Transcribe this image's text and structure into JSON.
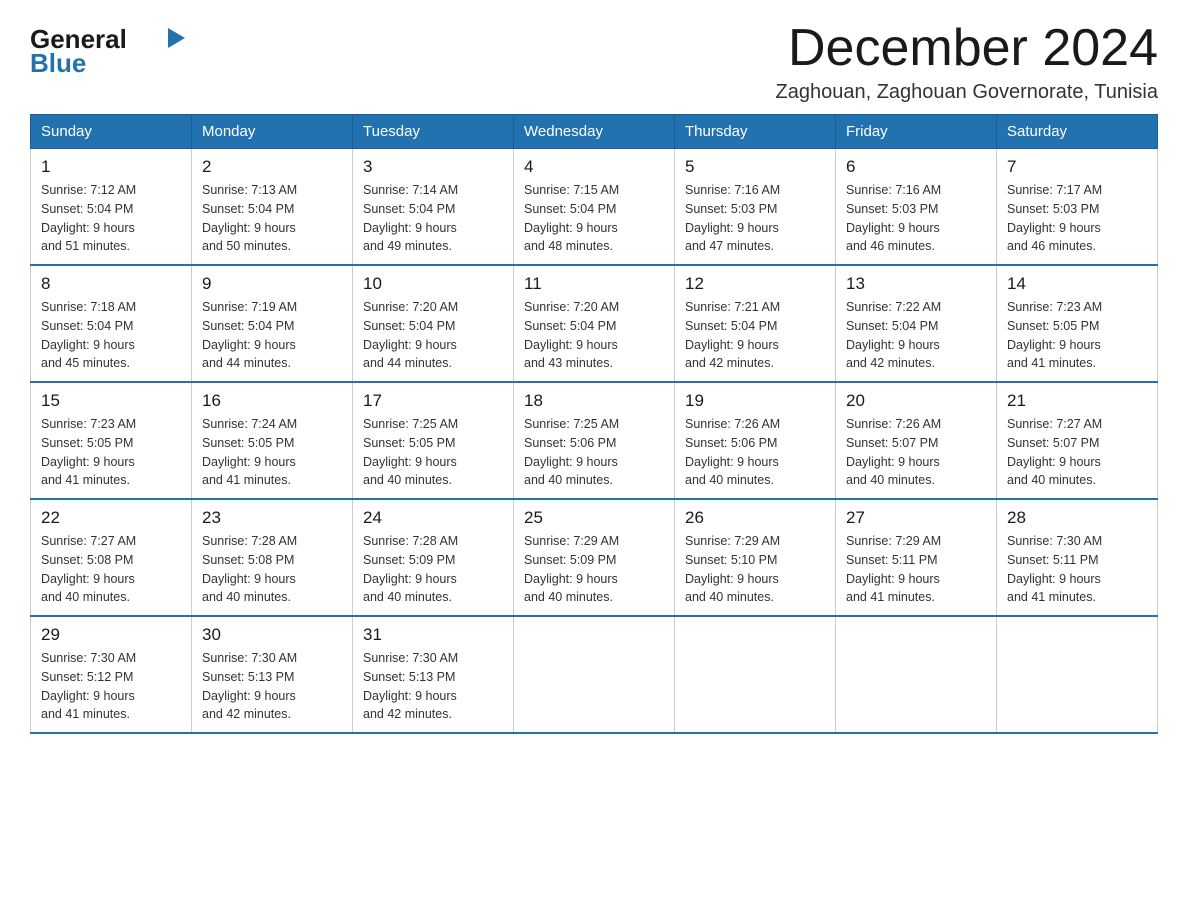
{
  "header": {
    "logo_text_general": "General",
    "logo_text_blue": "Blue",
    "month_title": "December 2024",
    "location": "Zaghouan, Zaghouan Governorate, Tunisia"
  },
  "weekdays": [
    "Sunday",
    "Monday",
    "Tuesday",
    "Wednesday",
    "Thursday",
    "Friday",
    "Saturday"
  ],
  "weeks": [
    [
      {
        "day": "1",
        "sunrise": "7:12 AM",
        "sunset": "5:04 PM",
        "daylight": "9 hours and 51 minutes."
      },
      {
        "day": "2",
        "sunrise": "7:13 AM",
        "sunset": "5:04 PM",
        "daylight": "9 hours and 50 minutes."
      },
      {
        "day": "3",
        "sunrise": "7:14 AM",
        "sunset": "5:04 PM",
        "daylight": "9 hours and 49 minutes."
      },
      {
        "day": "4",
        "sunrise": "7:15 AM",
        "sunset": "5:04 PM",
        "daylight": "9 hours and 48 minutes."
      },
      {
        "day": "5",
        "sunrise": "7:16 AM",
        "sunset": "5:03 PM",
        "daylight": "9 hours and 47 minutes."
      },
      {
        "day": "6",
        "sunrise": "7:16 AM",
        "sunset": "5:03 PM",
        "daylight": "9 hours and 46 minutes."
      },
      {
        "day": "7",
        "sunrise": "7:17 AM",
        "sunset": "5:03 PM",
        "daylight": "9 hours and 46 minutes."
      }
    ],
    [
      {
        "day": "8",
        "sunrise": "7:18 AM",
        "sunset": "5:04 PM",
        "daylight": "9 hours and 45 minutes."
      },
      {
        "day": "9",
        "sunrise": "7:19 AM",
        "sunset": "5:04 PM",
        "daylight": "9 hours and 44 minutes."
      },
      {
        "day": "10",
        "sunrise": "7:20 AM",
        "sunset": "5:04 PM",
        "daylight": "9 hours and 44 minutes."
      },
      {
        "day": "11",
        "sunrise": "7:20 AM",
        "sunset": "5:04 PM",
        "daylight": "9 hours and 43 minutes."
      },
      {
        "day": "12",
        "sunrise": "7:21 AM",
        "sunset": "5:04 PM",
        "daylight": "9 hours and 42 minutes."
      },
      {
        "day": "13",
        "sunrise": "7:22 AM",
        "sunset": "5:04 PM",
        "daylight": "9 hours and 42 minutes."
      },
      {
        "day": "14",
        "sunrise": "7:23 AM",
        "sunset": "5:05 PM",
        "daylight": "9 hours and 41 minutes."
      }
    ],
    [
      {
        "day": "15",
        "sunrise": "7:23 AM",
        "sunset": "5:05 PM",
        "daylight": "9 hours and 41 minutes."
      },
      {
        "day": "16",
        "sunrise": "7:24 AM",
        "sunset": "5:05 PM",
        "daylight": "9 hours and 41 minutes."
      },
      {
        "day": "17",
        "sunrise": "7:25 AM",
        "sunset": "5:05 PM",
        "daylight": "9 hours and 40 minutes."
      },
      {
        "day": "18",
        "sunrise": "7:25 AM",
        "sunset": "5:06 PM",
        "daylight": "9 hours and 40 minutes."
      },
      {
        "day": "19",
        "sunrise": "7:26 AM",
        "sunset": "5:06 PM",
        "daylight": "9 hours and 40 minutes."
      },
      {
        "day": "20",
        "sunrise": "7:26 AM",
        "sunset": "5:07 PM",
        "daylight": "9 hours and 40 minutes."
      },
      {
        "day": "21",
        "sunrise": "7:27 AM",
        "sunset": "5:07 PM",
        "daylight": "9 hours and 40 minutes."
      }
    ],
    [
      {
        "day": "22",
        "sunrise": "7:27 AM",
        "sunset": "5:08 PM",
        "daylight": "9 hours and 40 minutes."
      },
      {
        "day": "23",
        "sunrise": "7:28 AM",
        "sunset": "5:08 PM",
        "daylight": "9 hours and 40 minutes."
      },
      {
        "day": "24",
        "sunrise": "7:28 AM",
        "sunset": "5:09 PM",
        "daylight": "9 hours and 40 minutes."
      },
      {
        "day": "25",
        "sunrise": "7:29 AM",
        "sunset": "5:09 PM",
        "daylight": "9 hours and 40 minutes."
      },
      {
        "day": "26",
        "sunrise": "7:29 AM",
        "sunset": "5:10 PM",
        "daylight": "9 hours and 40 minutes."
      },
      {
        "day": "27",
        "sunrise": "7:29 AM",
        "sunset": "5:11 PM",
        "daylight": "9 hours and 41 minutes."
      },
      {
        "day": "28",
        "sunrise": "7:30 AM",
        "sunset": "5:11 PM",
        "daylight": "9 hours and 41 minutes."
      }
    ],
    [
      {
        "day": "29",
        "sunrise": "7:30 AM",
        "sunset": "5:12 PM",
        "daylight": "9 hours and 41 minutes."
      },
      {
        "day": "30",
        "sunrise": "7:30 AM",
        "sunset": "5:13 PM",
        "daylight": "9 hours and 42 minutes."
      },
      {
        "day": "31",
        "sunrise": "7:30 AM",
        "sunset": "5:13 PM",
        "daylight": "9 hours and 42 minutes."
      },
      null,
      null,
      null,
      null
    ]
  ],
  "labels": {
    "sunrise": "Sunrise:",
    "sunset": "Sunset:",
    "daylight": "Daylight:"
  }
}
